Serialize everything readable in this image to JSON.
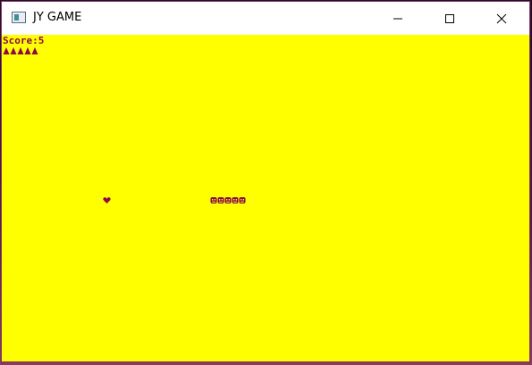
{
  "window": {
    "title": "JY GAME",
    "icon": "app-window-icon",
    "controls": [
      "minimize-icon",
      "maximize-icon",
      "close-icon"
    ]
  },
  "game": {
    "background_color": "#ffff00",
    "text_color": "#8a0a4a",
    "score_text": "Score:5",
    "lives_count": 5,
    "lives_icon": "triangle-icon",
    "food_icon": "heart-icon",
    "snake_length": 5,
    "snake_segment_icon": "smiley-segment-icon"
  }
}
